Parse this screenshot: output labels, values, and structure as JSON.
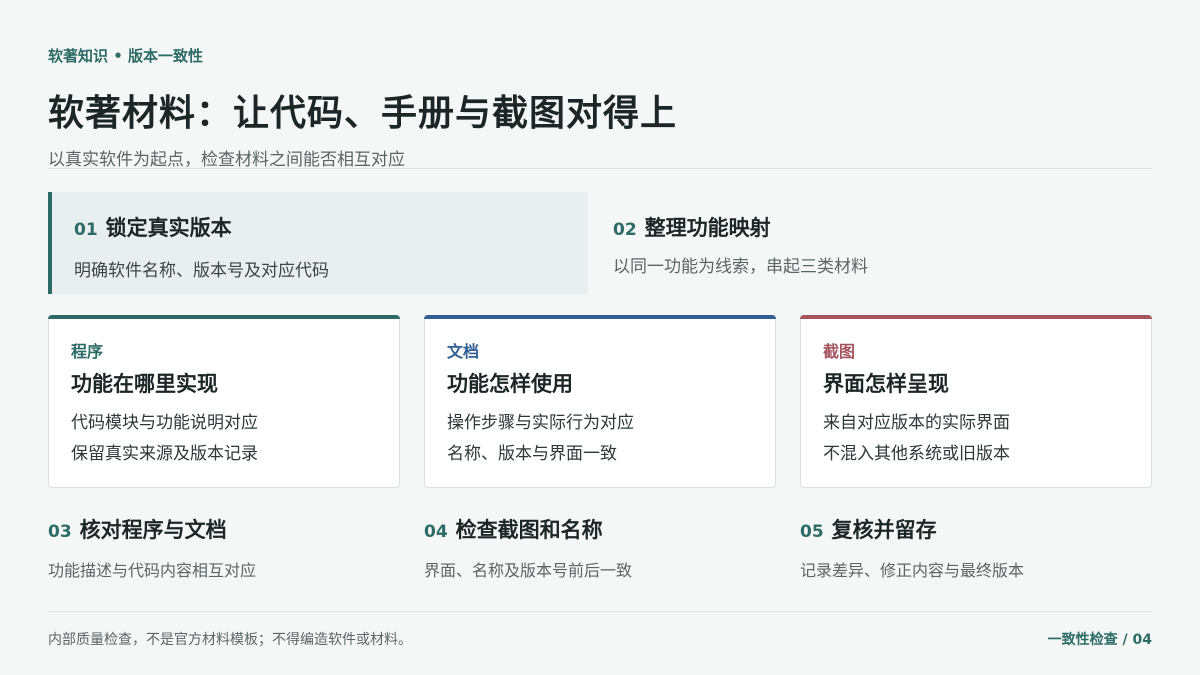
{
  "header": {
    "eyebrow": "软著知识 • 版本一致性",
    "title": "软著材料：让代码、手册与截图对得上",
    "subtitle": "以真实软件为起点，检查材料之间能否相互对应"
  },
  "steps": [
    {
      "num": "01",
      "title": "锁定真实版本",
      "desc": "明确软件名称、版本号及对应代码",
      "active": true
    },
    {
      "num": "02",
      "title": "整理功能映射",
      "desc": "以同一功能为线索，串起三类材料",
      "active": false
    },
    {
      "num": "03",
      "title": "核对程序与文档",
      "desc": "功能描述与代码内容相互对应"
    },
    {
      "num": "04",
      "title": "检查截图和名称",
      "desc": "界面、名称及版本号前后一致"
    },
    {
      "num": "05",
      "title": "复核并留存",
      "desc": "记录差异、修正内容与最终版本"
    }
  ],
  "cards": [
    {
      "tag": "程序",
      "title": "功能在哪里实现",
      "lines": [
        "代码模块与功能说明对应",
        "保留真实来源及版本记录"
      ],
      "color": "#2c6b66"
    },
    {
      "tag": "文档",
      "title": "功能怎样使用",
      "lines": [
        "操作步骤与实际行为对应",
        "名称、版本与界面一致"
      ],
      "color": "#2f5f93"
    },
    {
      "tag": "截图",
      "title": "界面怎样呈现",
      "lines": [
        "来自对应版本的实际界面",
        "不混入其他系统或旧版本"
      ],
      "color": "#a4555f"
    }
  ],
  "footer": {
    "note": "内部质量检查，不是官方材料模板；不得编造软件或材料。",
    "page": "一致性检查 / 04"
  }
}
